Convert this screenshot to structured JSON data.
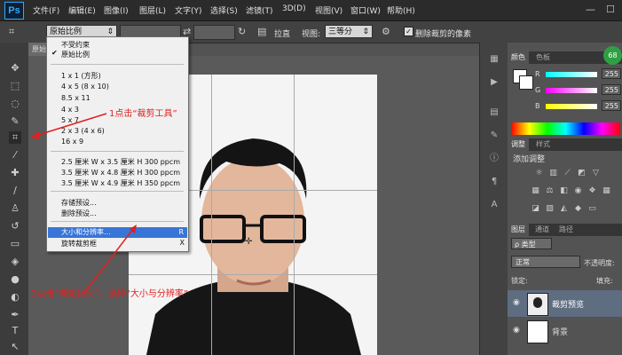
{
  "app": {
    "logo": "Ps"
  },
  "menubar": {
    "items": [
      "文件(F)",
      "编辑(E)",
      "图像(I)",
      "图层(L)",
      "文字(Y)",
      "选择(S)",
      "滤镜(T)",
      "3D(D)",
      "视图(V)",
      "窗口(W)",
      "帮助(H)"
    ],
    "minimize": "—",
    "restore": "☐"
  },
  "options": {
    "ratio_value": "原始比例",
    "straighten": "拉直",
    "view_label": "视图:",
    "view_value": "三等分",
    "delete_cropped": "删除裁剪的像素"
  },
  "ratio_menu": {
    "items": [
      {
        "label": "不受约束",
        "checked": false,
        "highlighted": false,
        "shortcut": ""
      },
      {
        "label": "原始比例",
        "checked": true,
        "highlighted": false,
        "shortcut": ""
      },
      {
        "label": "1 x 1 (方形)",
        "checked": false,
        "highlighted": false,
        "shortcut": ""
      },
      {
        "label": "4 x 5 (8 x 10)",
        "checked": false,
        "highlighted": false,
        "shortcut": ""
      },
      {
        "label": "8.5 x 11",
        "checked": false,
        "highlighted": false,
        "shortcut": ""
      },
      {
        "label": "4 x 3",
        "checked": false,
        "highlighted": false,
        "shortcut": ""
      },
      {
        "label": "5 x 7",
        "checked": false,
        "highlighted": false,
        "shortcut": ""
      },
      {
        "label": "2 x 3 (4 x 6)",
        "checked": false,
        "highlighted": false,
        "shortcut": ""
      },
      {
        "label": "16 x 9",
        "checked": false,
        "highlighted": false,
        "shortcut": ""
      },
      {
        "label": "2.5 厘米 W x 3.5 厘米 H 300 ppcm",
        "checked": false,
        "highlighted": false,
        "shortcut": ""
      },
      {
        "label": "3.5 厘米 W x 4.8 厘米 H 300 ppcm",
        "checked": false,
        "highlighted": false,
        "shortcut": ""
      },
      {
        "label": "3.5 厘米 W x 4.9 厘米 H 350 ppcm",
        "checked": false,
        "highlighted": false,
        "shortcut": ""
      },
      {
        "label": "存储预设...",
        "checked": false,
        "highlighted": false,
        "shortcut": ""
      },
      {
        "label": "删除预设...",
        "checked": false,
        "highlighted": false,
        "shortcut": ""
      },
      {
        "label": "大小和分辨率...",
        "checked": false,
        "highlighted": true,
        "shortcut": "R"
      },
      {
        "label": "旋转裁剪框",
        "checked": false,
        "highlighted": false,
        "shortcut": "X"
      }
    ]
  },
  "color_panel": {
    "tabs": [
      "颜色",
      "色板"
    ],
    "channels": [
      {
        "label": "R",
        "value": "255"
      },
      {
        "label": "G",
        "value": "255"
      },
      {
        "label": "B",
        "value": "255"
      }
    ],
    "badge": "68"
  },
  "adjust_panel": {
    "tabs": [
      "调整",
      "样式"
    ],
    "title": "添加调整"
  },
  "layers_panel": {
    "tabs": [
      "图层",
      "通道",
      "路径"
    ],
    "kind": "ρ 类型",
    "blend_mode": "正常",
    "opacity_label": "不透明度:",
    "lock_label": "锁定:",
    "fill_label": "填充:",
    "layers": [
      {
        "name": "裁剪预览",
        "selected": true
      },
      {
        "name": "背景",
        "selected": false
      }
    ]
  },
  "annotations": {
    "step1": "1点击“裁剪工具”",
    "step2": "2点击“原始比例”，选择“大小与分辨率”"
  },
  "colors": {
    "annotation": "#e02020",
    "highlight": "#3875d7",
    "accent": "#31a8ff"
  }
}
